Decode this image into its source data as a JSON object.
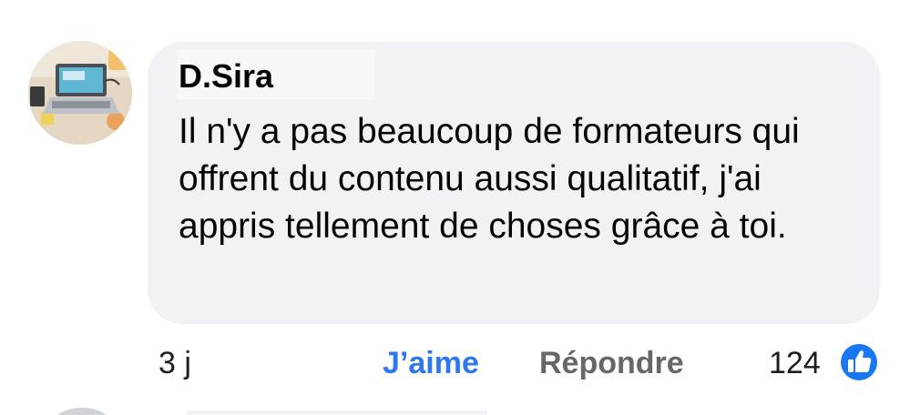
{
  "comment": {
    "author": "D.Sira",
    "text": "Il n'y a pas beaucoup de formateurs qui offrent du contenu aussi qualitatif, j'ai appris tellement de choses grâce à toi.",
    "time": "3 j",
    "like_label": "J’aime",
    "reply_label": "Répondre",
    "reaction_count": "124",
    "reaction_icon": "thumbs-up-icon",
    "avatar_icon": "laptop-desk-photo"
  },
  "colors": {
    "bubble": "#f0f2f5",
    "like_link": "#2d78ee",
    "reply_link": "#65676b",
    "reaction_badge": "#1877f2"
  }
}
